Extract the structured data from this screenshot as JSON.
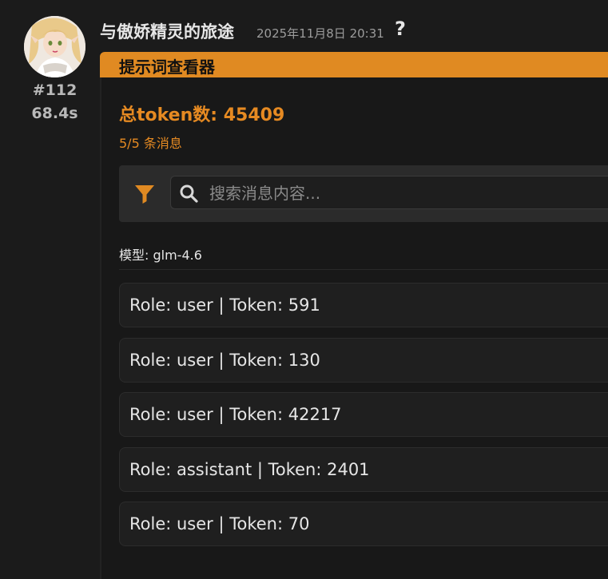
{
  "message": {
    "index": "#112",
    "duration": "68.4s",
    "character_name": "与傲娇精灵的旅途",
    "timestamp": "2025年11月8日 20:31",
    "help_icon": "question-icon"
  },
  "panel": {
    "title": "提示词查看器",
    "total_tokens": "总token数: 45409",
    "message_count": "5/5 条消息",
    "search": {
      "placeholder": "搜索消息内容...",
      "value": ""
    },
    "model": "模型: glm-4.6",
    "messages": [
      {
        "label": "Role: user | Token: 591"
      },
      {
        "label": "Role: user | Token: 130"
      },
      {
        "label": "Role: user | Token: 42217"
      },
      {
        "label": "Role: assistant | Token: 2401"
      },
      {
        "label": "Role: user | Token: 70"
      }
    ]
  },
  "colors": {
    "accent": "#e08a22",
    "background": "#1b1b1b",
    "panel_bg": "#181818",
    "filter_bar_bg": "#2b2b2b"
  }
}
